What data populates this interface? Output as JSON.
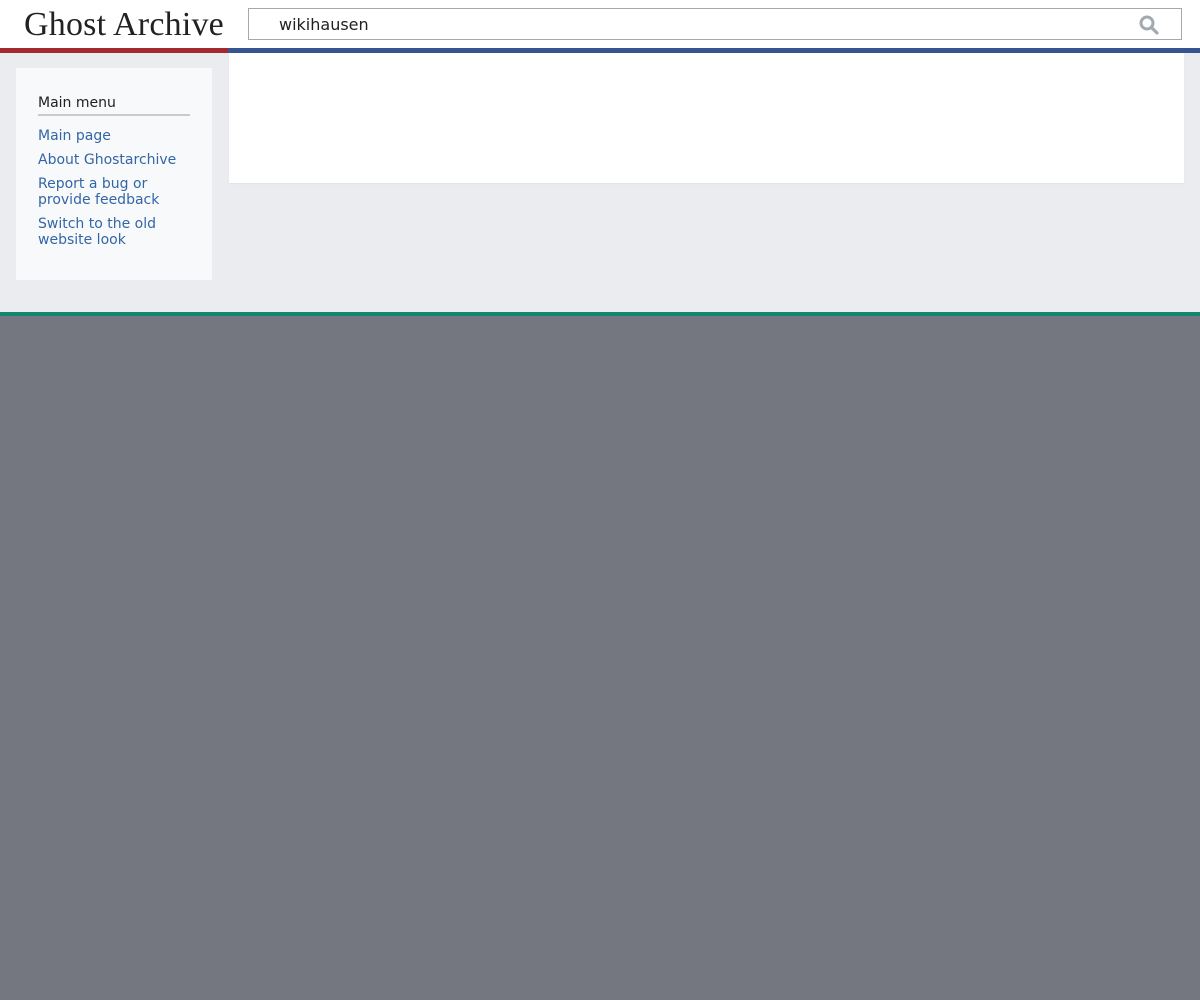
{
  "header": {
    "site_name": "Ghost Archive",
    "search": {
      "value": "wikihausen",
      "icon": "search-icon"
    }
  },
  "sidebar": {
    "heading": "Main menu",
    "items": [
      {
        "label": "Main page"
      },
      {
        "label": "About Ghostarchive"
      },
      {
        "label": "Report a bug or provide feedback"
      },
      {
        "label": "Switch to the old website look"
      }
    ]
  },
  "colors": {
    "logo_underline": "#a3282f",
    "header_underline": "#36558f",
    "footer_line": "#14866d",
    "link": "#3366a6",
    "page_background": "#eaecf0",
    "footer_background": "#74777f"
  }
}
